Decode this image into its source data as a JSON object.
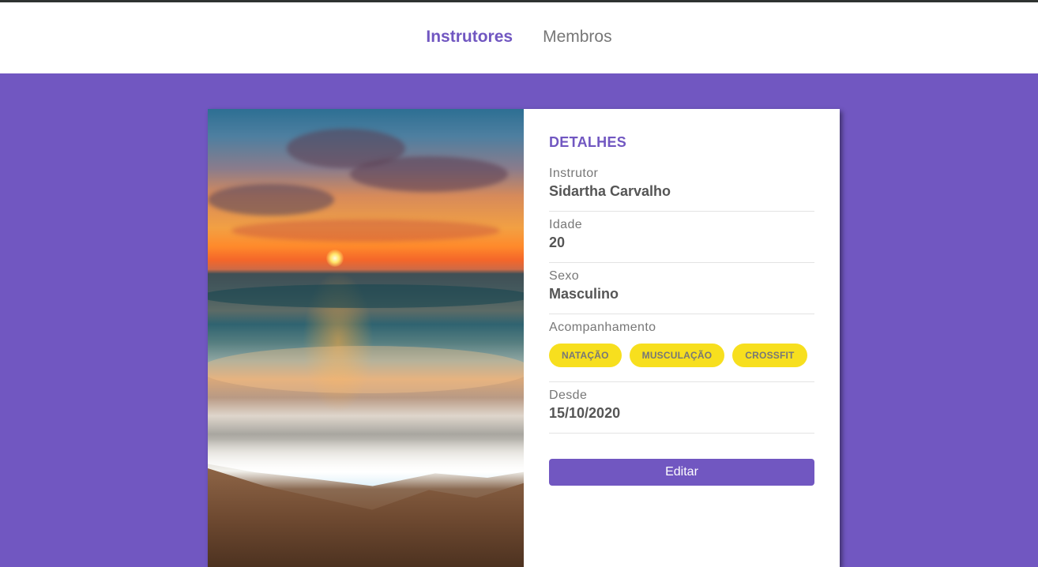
{
  "nav": {
    "links": [
      {
        "label": "Instrutores",
        "active": true
      },
      {
        "label": "Membros",
        "active": false
      }
    ]
  },
  "card": {
    "title": "DETALHES",
    "fields": {
      "instructor": {
        "label": "Instrutor",
        "value": "Sidartha Carvalho"
      },
      "age": {
        "label": "Idade",
        "value": "20"
      },
      "gender": {
        "label": "Sexo",
        "value": "Masculino"
      },
      "services": {
        "label": "Acompanhamento",
        "tags": [
          "NATAÇÃO",
          "MUSCULAÇÃO",
          "CROSSFIT"
        ]
      },
      "since": {
        "label": "Desde",
        "value": "15/10/2020"
      }
    },
    "edit_label": "Editar"
  },
  "colors": {
    "primary": "#7157c1",
    "tag": "#f7df1e",
    "text_muted": "#777777",
    "text_strong": "#555555"
  }
}
